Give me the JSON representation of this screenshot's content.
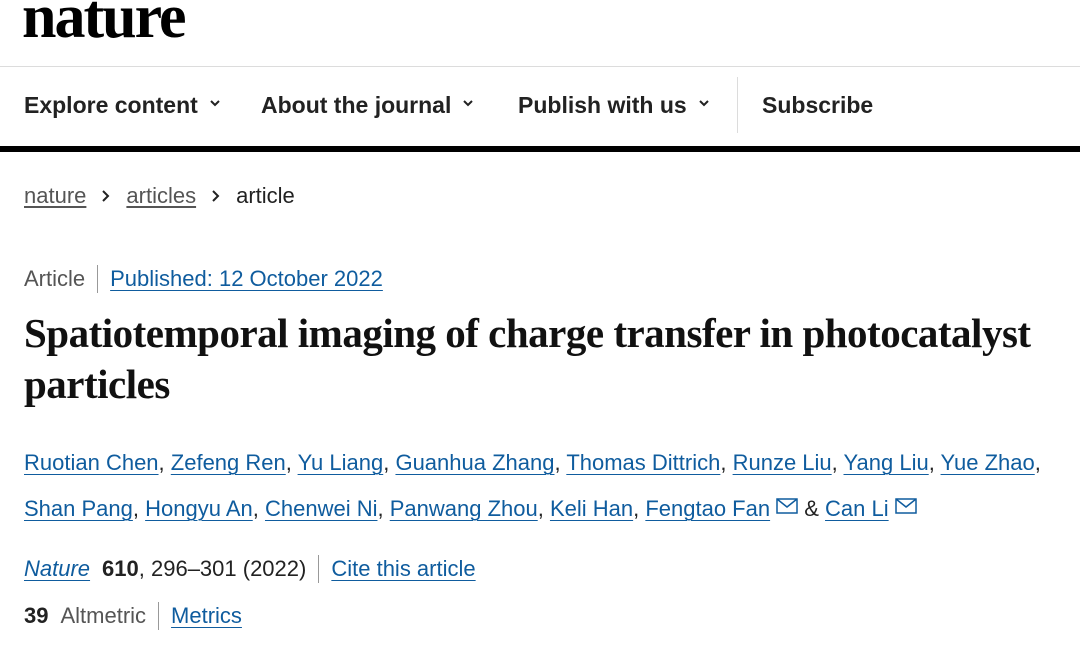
{
  "brand": {
    "logo_text": "nature"
  },
  "nav": {
    "items": [
      {
        "label": "Explore content"
      },
      {
        "label": "About the journal"
      },
      {
        "label": "Publish with us"
      }
    ],
    "subscribe_label": "Subscribe"
  },
  "breadcrumb": {
    "items": [
      {
        "label": "nature"
      },
      {
        "label": "articles"
      }
    ],
    "current": "article"
  },
  "article": {
    "type": "Article",
    "published": "Published: 12 October 2022",
    "title": "Spatiotemporal imaging of charge transfer in photocatalyst particles",
    "authors": [
      "Ruotian Chen",
      "Zefeng Ren",
      "Yu Liang",
      "Guanhua Zhang",
      "Thomas Dittrich",
      "Runze Liu",
      "Yang Liu",
      "Yue Zhao",
      "Shan Pang",
      "Hongyu An",
      "Chenwei Ni",
      "Panwang Zhou",
      "Keli Han",
      "Fengtao Fan",
      "Can Li"
    ],
    "author_joiner": "&",
    "citation": {
      "journal": "Nature",
      "volume": "610",
      "pages_year": ", 296–301 (2022)",
      "cite_label": "Cite this article"
    },
    "metrics": {
      "altmetric_score": "39",
      "altmetric_label": "Altmetric",
      "metrics_label": "Metrics"
    }
  },
  "colors": {
    "link": "#0f5c9e",
    "rule": "#000000"
  },
  "icons": [
    "chevron-down-icon",
    "chevron-right-icon",
    "mail-icon"
  ]
}
